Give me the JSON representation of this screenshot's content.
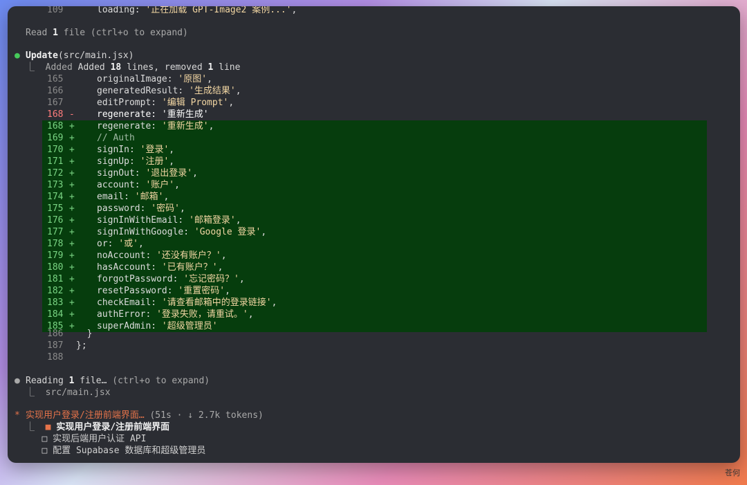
{
  "top_line": {
    "num": "109",
    "code_key": "loading: ",
    "code_str": "'正在加载 GPT-Image2 案例...'",
    "code_tail": ","
  },
  "read_line": {
    "text": "Read ",
    "count": "1",
    "tail": " file (ctrl+o to expand)"
  },
  "update": {
    "bullet": "●",
    "label": "Update",
    "path": "(src/main.jsx)",
    "summary_prefix": "⎿  Added ",
    "added": "18",
    "summary_mid": " lines, removed ",
    "removed": "1",
    "summary_suffix": " line"
  },
  "context_before": [
    {
      "num": "165",
      "key": "originalImage: ",
      "str": "'原图'",
      "tail": ","
    },
    {
      "num": "166",
      "key": "generatedResult: ",
      "str": "'生成结果'",
      "tail": ","
    },
    {
      "num": "167",
      "key": "editPrompt: ",
      "str": "'编辑 Prompt'",
      "tail": ","
    }
  ],
  "removed_line": {
    "num": "168",
    "sign": "-",
    "key": "regenerate: ",
    "str": "'重新生成'",
    "tail": ""
  },
  "added_lines": [
    {
      "num": "168",
      "sign": "+",
      "key": "regenerate: ",
      "str": "'重新生成'",
      "tail": ","
    },
    {
      "num": "169",
      "sign": "+",
      "comment": "// Auth"
    },
    {
      "num": "170",
      "sign": "+",
      "key": "signIn: ",
      "str": "'登录'",
      "tail": ","
    },
    {
      "num": "171",
      "sign": "+",
      "key": "signUp: ",
      "str": "'注册'",
      "tail": ","
    },
    {
      "num": "172",
      "sign": "+",
      "key": "signOut: ",
      "str": "'退出登录'",
      "tail": ","
    },
    {
      "num": "173",
      "sign": "+",
      "key": "account: ",
      "str": "'账户'",
      "tail": ","
    },
    {
      "num": "174",
      "sign": "+",
      "key": "email: ",
      "str": "'邮箱'",
      "tail": ","
    },
    {
      "num": "175",
      "sign": "+",
      "key": "password: ",
      "str": "'密码'",
      "tail": ","
    },
    {
      "num": "176",
      "sign": "+",
      "key": "signInWithEmail: ",
      "str": "'邮箱登录'",
      "tail": ","
    },
    {
      "num": "177",
      "sign": "+",
      "key": "signInWithGoogle: ",
      "str": "'Google 登录'",
      "tail": ","
    },
    {
      "num": "178",
      "sign": "+",
      "key": "or: ",
      "str": "'或'",
      "tail": ","
    },
    {
      "num": "179",
      "sign": "+",
      "key": "noAccount: ",
      "str": "'还没有账户？'",
      "tail": ","
    },
    {
      "num": "180",
      "sign": "+",
      "key": "hasAccount: ",
      "str": "'已有账户？'",
      "tail": ","
    },
    {
      "num": "181",
      "sign": "+",
      "key": "forgotPassword: ",
      "str": "'忘记密码？'",
      "tail": ","
    },
    {
      "num": "182",
      "sign": "+",
      "key": "resetPassword: ",
      "str": "'重置密码'",
      "tail": ","
    },
    {
      "num": "183",
      "sign": "+",
      "key": "checkEmail: ",
      "str": "'请查看邮箱中的登录链接'",
      "tail": ","
    },
    {
      "num": "184",
      "sign": "+",
      "key": "authError: ",
      "str": "'登录失败，请重试。'",
      "tail": ","
    },
    {
      "num": "185",
      "sign": "+",
      "key": "superAdmin: ",
      "str": "'超级管理员'",
      "tail": ""
    }
  ],
  "context_after": [
    {
      "num": "186",
      "code": "  }"
    },
    {
      "num": "187",
      "code": "};"
    },
    {
      "num": "188",
      "code": ""
    }
  ],
  "reading": {
    "bullet": "●",
    "prefix": "Reading ",
    "count": "1",
    "label": " file…",
    "hint": " (ctrl+o to expand)",
    "sub": "⎿  src/main.jsx"
  },
  "status": {
    "spinner": "*",
    "title": "实现用户登录/注册前端界面…",
    "meta": " (51s · ↓ 2.7k tokens)"
  },
  "tasks": [
    {
      "prefix": "⎿  ",
      "box": "■",
      "label": "实现用户登录/注册前端界面",
      "state": "active"
    },
    {
      "prefix": "   ",
      "box": "□",
      "label": "实现后端用户认证 API",
      "state": "pending"
    },
    {
      "prefix": "   ",
      "box": "□",
      "label": "配置 Supabase 数据库和超级管理员",
      "state": "pending"
    }
  ],
  "watermark": "苍何"
}
